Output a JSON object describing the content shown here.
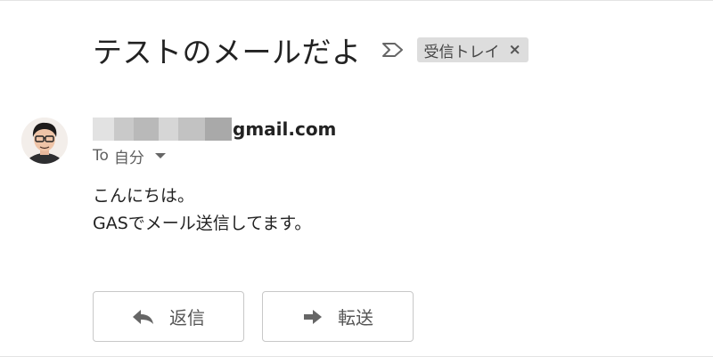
{
  "message": {
    "subject": "テストのメールだよ",
    "label_chip": {
      "text": "受信トレイ",
      "remove_symbol": "×"
    },
    "sender": {
      "domain_text": "gmail.com"
    },
    "recipient": {
      "to_label": "To",
      "name": "自分"
    },
    "body_lines": [
      "こんにちは。",
      "GASでメール送信してます。"
    ]
  },
  "actions": {
    "reply_label": "返信",
    "forward_label": "転送"
  },
  "icons": {
    "importance": "importance-marker-icon",
    "reply": "reply-arrow-icon",
    "forward": "forward-arrow-icon",
    "dropdown": "chevron-down-icon"
  },
  "colors": {
    "label_chip_bg": "#dddddd",
    "text_primary": "#222222",
    "text_secondary": "#5f5f5f",
    "button_border": "#c8c8c8",
    "icon_gray": "#666666"
  }
}
